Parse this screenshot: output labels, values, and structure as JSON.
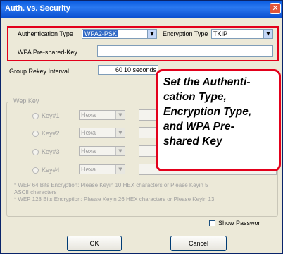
{
  "window": {
    "title": "Auth. vs. Security",
    "close_glyph": "✕"
  },
  "auth": {
    "auth_type_label": "Authentication Type",
    "auth_type_value": "WPA2-PSK",
    "enc_type_label": "Encryption Type",
    "enc_type_value": "TKIP",
    "psk_label": "WPA Pre-shared-Key",
    "psk_value": ""
  },
  "rekey": {
    "label": "Group Rekey Interval",
    "value": "60",
    "unit": "10 seconds"
  },
  "wep": {
    "group_label": "Wep Key",
    "keys": [
      {
        "label": "Key#1",
        "format": "Hexa"
      },
      {
        "label": "Key#2",
        "format": "Hexa"
      },
      {
        "label": "Key#3",
        "format": "Hexa"
      },
      {
        "label": "Key#4",
        "format": "Hexa"
      }
    ],
    "note1": "* WEP 64 Bits Encryption:  Please Keyin 10 HEX characters  or  Please Keyin 5",
    "note1b": "ASCII characters",
    "note2": "* WEP 128 Bits Encryption:  Please Keyin 26 HEX characters  or  Please Keyin 13"
  },
  "callout": {
    "lines": [
      "Set the Authenti-",
      "cation Type,",
      "Encryption Type,",
      "and WPA Pre-",
      "shared Key"
    ]
  },
  "show_password_label": "Show Passwor",
  "buttons": {
    "ok": "OK",
    "cancel": "Cancel"
  },
  "colors": {
    "accent_red": "#e3001b",
    "titlebar_blue": "#0a5ce0",
    "window_bg": "#ece9d8"
  }
}
